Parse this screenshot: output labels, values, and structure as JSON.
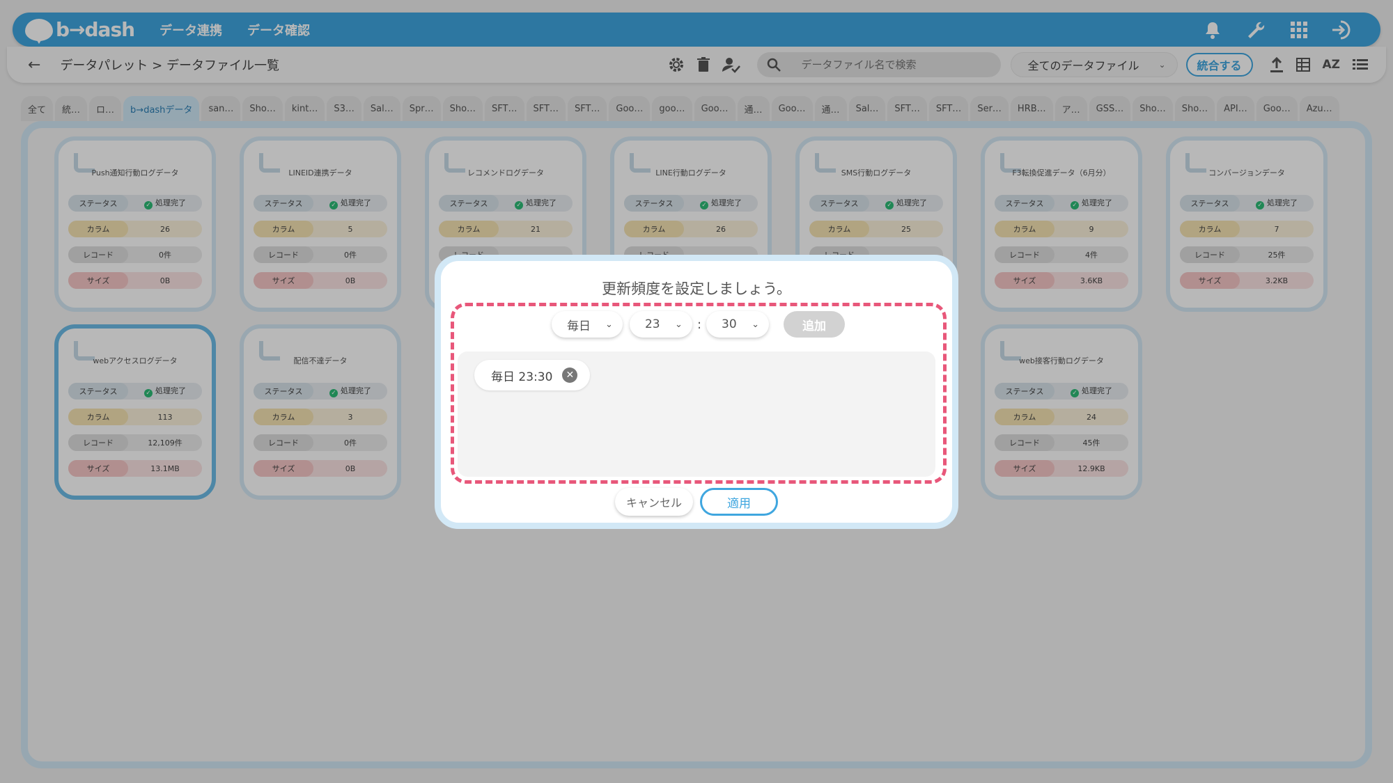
{
  "header": {
    "logo_text": "b→dash",
    "nav": [
      "データ連携",
      "データ確認"
    ],
    "icons": [
      "bell-icon",
      "wrench-icon",
      "grid-icon",
      "logout-icon"
    ]
  },
  "subbar": {
    "breadcrumb": "データパレット > データファイル一覧",
    "search_placeholder": "データファイル名で検索",
    "filter_value": "全てのデータファイル",
    "merge_label": "統合する",
    "sort_label": "AZ"
  },
  "tabs": [
    "全て",
    "統…",
    "ロ…",
    "b→dashデータ",
    "san…",
    "Sho…",
    "kint…",
    "S3…",
    "Sal…",
    "Spr…",
    "Sho…",
    "SFT…",
    "SFT…",
    "SFT…",
    "Goo…",
    "goo…",
    "Goo…",
    "通…",
    "Goo…",
    "通…",
    "Sal…",
    "SFT…",
    "SFT…",
    "Ser…",
    "HRB…",
    "ア…",
    "GSS…",
    "Sho…",
    "Sho…",
    "API…",
    "Goo…",
    "Azu…"
  ],
  "labels": {
    "status": "ステータス",
    "column": "カラム",
    "record": "レコード",
    "size": "サイズ",
    "done": "処理完了"
  },
  "cards": [
    {
      "title": "Push通知行動ログデータ",
      "columns": "26",
      "records": "0件",
      "size": "0B"
    },
    {
      "title": "LINEID連携データ",
      "columns": "5",
      "records": "0件",
      "size": "0B"
    },
    {
      "title": "レコメンドログデータ",
      "columns": "21",
      "records": "",
      "size": ""
    },
    {
      "title": "LINE行動ログデータ",
      "columns": "26",
      "records": "",
      "size": ""
    },
    {
      "title": "SMS行動ログデータ",
      "columns": "25",
      "records": "",
      "size": ""
    },
    {
      "title": "F3転換促進データ（6月分）",
      "columns": "9",
      "records": "4件",
      "size": "3.6KB"
    },
    {
      "title": "コンバージョンデータ",
      "columns": "7",
      "records": "25件",
      "size": "3.2KB"
    },
    {
      "title": "webアクセスログデータ",
      "columns": "113",
      "records": "12,109件",
      "size": "13.1MB"
    },
    {
      "title": "配信不達データ",
      "columns": "3",
      "records": "0件",
      "size": "0B"
    },
    {
      "title": "web接客行動ログデータ",
      "columns": "24",
      "records": "45件",
      "size": "12.9KB"
    }
  ],
  "modal": {
    "title": "更新頻度を設定しましょう。",
    "frequency": "毎日",
    "hour": "23",
    "minute": "30",
    "colon": ":",
    "add_label": "追加",
    "schedules": [
      "毎日 23:30"
    ],
    "cancel_label": "キャンセル",
    "apply_label": "適用"
  }
}
